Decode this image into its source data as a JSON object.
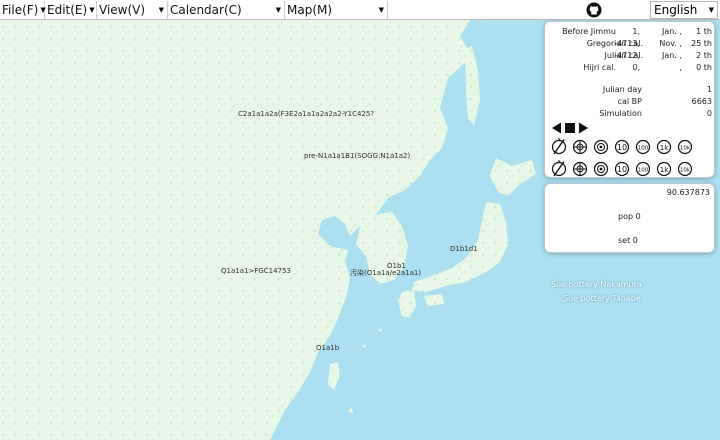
{
  "menubar": {
    "file": "File(F)",
    "edit": "Edit(E)",
    "view": "View(V)",
    "calendar": "Calendar(C)",
    "map": "Map(M)",
    "language": "English",
    "github_icon": "github-icon"
  },
  "calendars": [
    {
      "name": "Before Jimmu",
      "year": "1,",
      "month": "Jan. ,",
      "day": "1 th"
    },
    {
      "name": "Gregorian cal.",
      "year": "-4713,",
      "month": "Nov. ,",
      "day": "25 th"
    },
    {
      "name": "Julian cal.",
      "year": "-4712,",
      "month": "Jan. ,",
      "day": "2 th"
    },
    {
      "name": "Hijri cal.",
      "year": "0,",
      "month": ",",
      "day": "0 th"
    }
  ],
  "info": {
    "julian_day_label": "Julian day",
    "julian_day_value": "1",
    "cal_bp_label": "cal BP",
    "cal_bp_value": "6663",
    "simulation_label": "Simulation",
    "simulation_value": "0"
  },
  "controls": {
    "play_icons": [
      "step-back-icon",
      "stop-icon",
      "play-icon"
    ],
    "rows": [
      {
        "icons": [
          "no-compass-icon",
          "crosshair-icon",
          "target-icon"
        ],
        "numbers": [
          "10",
          "100",
          "1k",
          "10k"
        ]
      },
      {
        "icons": [
          "no-compass-icon",
          "crosshair-icon",
          "target-icon"
        ],
        "numbers": [
          "10",
          "100",
          "1k",
          "10k"
        ]
      }
    ]
  },
  "stats": {
    "value": "90.637873",
    "pop": "pop 0",
    "set": "set 0"
  },
  "map_labels": {
    "c2": "C2a1a1a2a(F3E2a1a1a2a2a2-Y1C425?",
    "n1": "pre-N1a1a1B1(SOGG:N1a1a2)",
    "q1": "Q1a1a1>FGC14753",
    "o1_korea": "O1b1",
    "o1_bohai": "汚染(O1a1a/e2a1a1)",
    "d1": "D1b1d1",
    "o1b": "O1a1b",
    "sue_nakamura": "Sue pottery Nakamura",
    "sue_tanabe": "Sue pottery Tanabe"
  },
  "colors": {
    "sea": "#ace0f0",
    "land": "#e6f7e6",
    "panel_border": "#b9c7d2"
  }
}
